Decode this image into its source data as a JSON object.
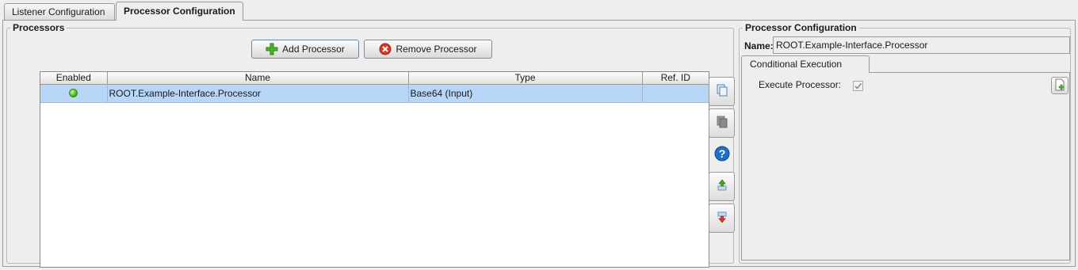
{
  "tabs": [
    {
      "label": "Listener Configuration",
      "active": false
    },
    {
      "label": "Processor Configuration",
      "active": true
    }
  ],
  "processors_panel": {
    "title": "Processors",
    "add_button": {
      "label": "Add Processor",
      "icon": "plus-icon"
    },
    "remove_button": {
      "label": "Remove Processor",
      "icon": "remove-icon"
    },
    "table": {
      "columns": [
        "Enabled",
        "Name",
        "Type",
        "Ref. ID"
      ],
      "rows": [
        {
          "enabled": true,
          "name": "ROOT.Example-Interface.Processor",
          "type": "Base64 (Input)",
          "ref_id": ""
        }
      ]
    },
    "side_buttons": [
      {
        "icon": "copy-icon",
        "enabled": true
      },
      {
        "icon": "paste-icon",
        "enabled": false
      },
      {
        "icon": "help-icon",
        "enabled": true
      },
      {
        "icon": "move-up-icon",
        "enabled": true
      },
      {
        "icon": "move-down-icon",
        "enabled": true
      }
    ]
  },
  "config_panel": {
    "title": "Processor Configuration",
    "name_label": "Name:",
    "name_value": "ROOT.Example-Interface.Processor",
    "subtab": "Conditional Execution",
    "execute_label": "Execute Processor:",
    "execute_checked": true,
    "add_condition_icon": "add-document-icon"
  },
  "colors": {
    "selection": "#b8d6f7",
    "background": "#eeeeee",
    "enabled_dot": "#49b61a",
    "remove": "#d9382a",
    "help": "#1f6fc4"
  }
}
